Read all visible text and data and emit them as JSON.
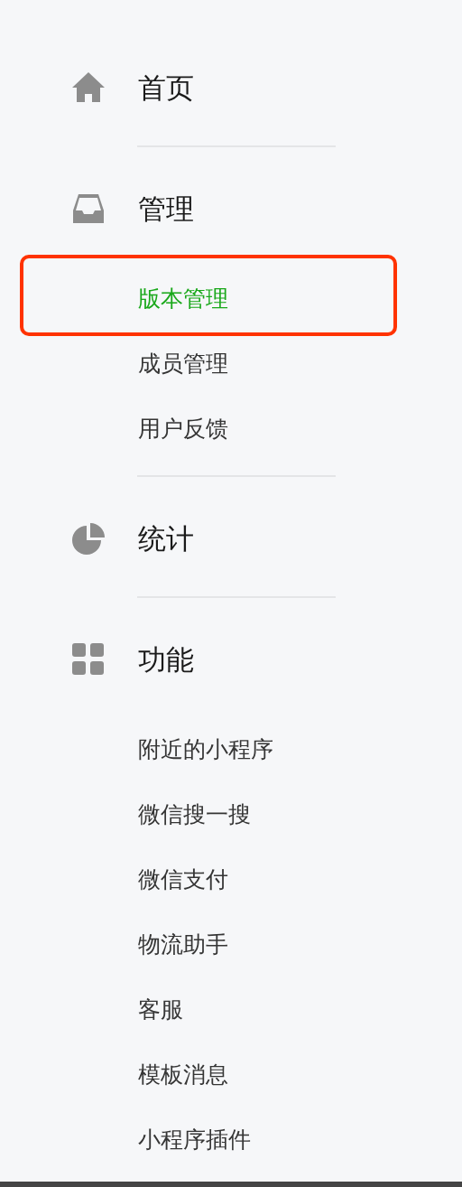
{
  "sidebar": {
    "sections": [
      {
        "title": "首页"
      },
      {
        "title": "管理",
        "items": [
          {
            "label": "版本管理",
            "selected": true,
            "highlighted": true
          },
          {
            "label": "成员管理",
            "selected": false,
            "highlighted": false
          },
          {
            "label": "用户反馈",
            "selected": false,
            "highlighted": false
          }
        ]
      },
      {
        "title": "统计"
      },
      {
        "title": "功能",
        "items": [
          {
            "label": "附近的小程序",
            "selected": false,
            "highlighted": false
          },
          {
            "label": "微信搜一搜",
            "selected": false,
            "highlighted": false
          },
          {
            "label": "微信支付",
            "selected": false,
            "highlighted": false
          },
          {
            "label": "物流助手",
            "selected": false,
            "highlighted": false
          },
          {
            "label": "客服",
            "selected": false,
            "highlighted": false
          },
          {
            "label": "模板消息",
            "selected": false,
            "highlighted": false
          },
          {
            "label": "小程序插件",
            "selected": false,
            "highlighted": false
          }
        ]
      }
    ]
  }
}
